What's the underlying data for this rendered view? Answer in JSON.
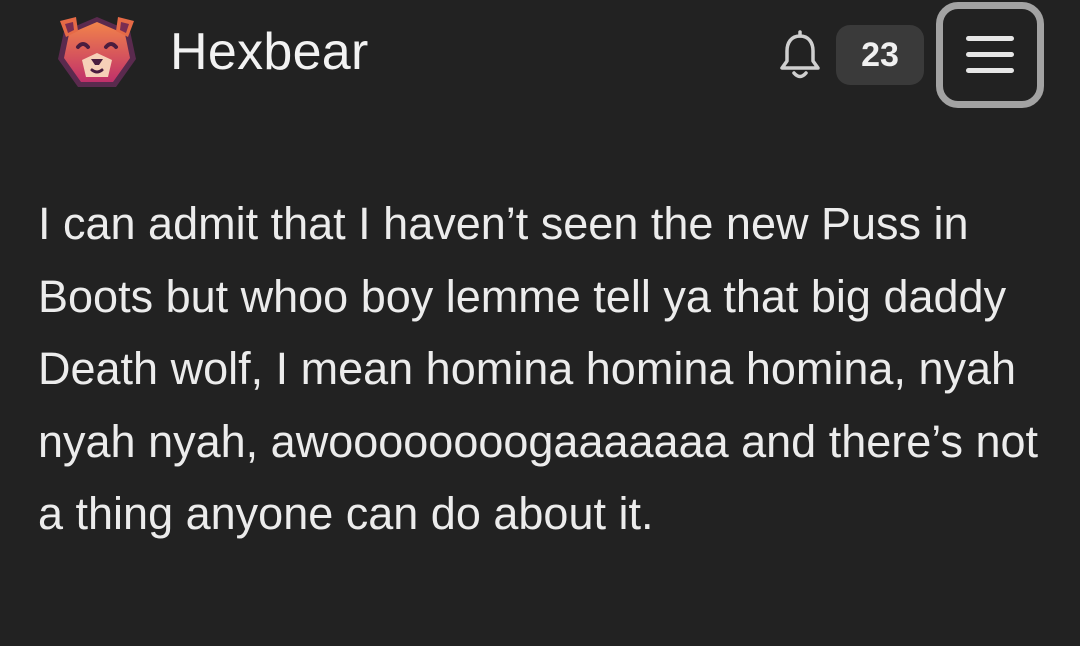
{
  "header": {
    "site_title": "Hexbear",
    "notification_count": "23",
    "icons": {
      "logo": "hexbear-logo-icon",
      "notifications": "bell-icon",
      "menu": "hamburger-menu-icon"
    }
  },
  "post": {
    "text": "I can admit that I haven’t seen the new Puss in Boots but whoo boy lemme tell ya that big daddy Death wolf, I mean homina homina homina, nyah nyah nyah, awoooooooogaaaaaaa and there’s not a thing anyone can do about it."
  },
  "colors": {
    "background": "#222222",
    "text": "#ececec",
    "badge_bg": "#3a3a3a",
    "menu_border": "#a3a3a3",
    "logo_gradient_top": "#f07a4a",
    "logo_gradient_bottom": "#c0306a"
  }
}
